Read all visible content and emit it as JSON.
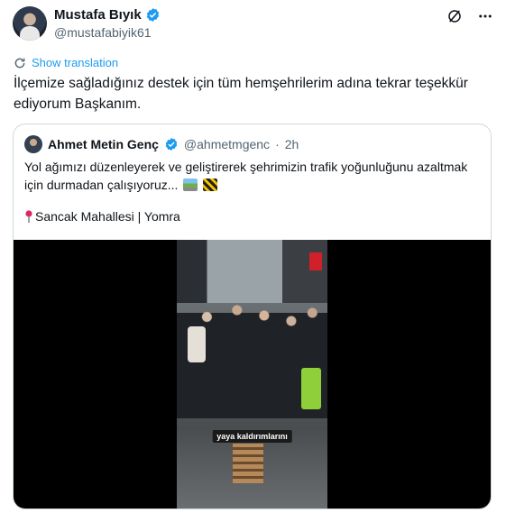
{
  "author": {
    "name": "Mustafa Bıyık",
    "handle": "@mustafabiyik61"
  },
  "translate_label": "Show translation",
  "tweet_text": "İlçemize sağladığınız destek için tüm hemşehrilerim adına tekrar teşekkür ediyorum Başkanım.",
  "quote": {
    "name": "Ahmet Metin Genç",
    "handle": "@ahmetmgenc",
    "separator": "·",
    "time": "2h",
    "text": "Yol ağımızı düzenleyerek ve geliştirerek şehrimizin trafik yoğunluğunu azaltmak için durmadan çalışıyoruz...",
    "location": "Sancak Mahallesi | Yomra",
    "video_caption": "yaya kaldırımlarını"
  },
  "icons": {
    "verified": "verified-badge-icon",
    "grok": "grok-icon",
    "more": "more-icon",
    "translate": "translate-icon",
    "pin": "location-pin-icon"
  },
  "colors": {
    "accent": "#1d9bf0",
    "text": "#0f1419",
    "muted": "#536471",
    "border": "#cfd9de"
  }
}
